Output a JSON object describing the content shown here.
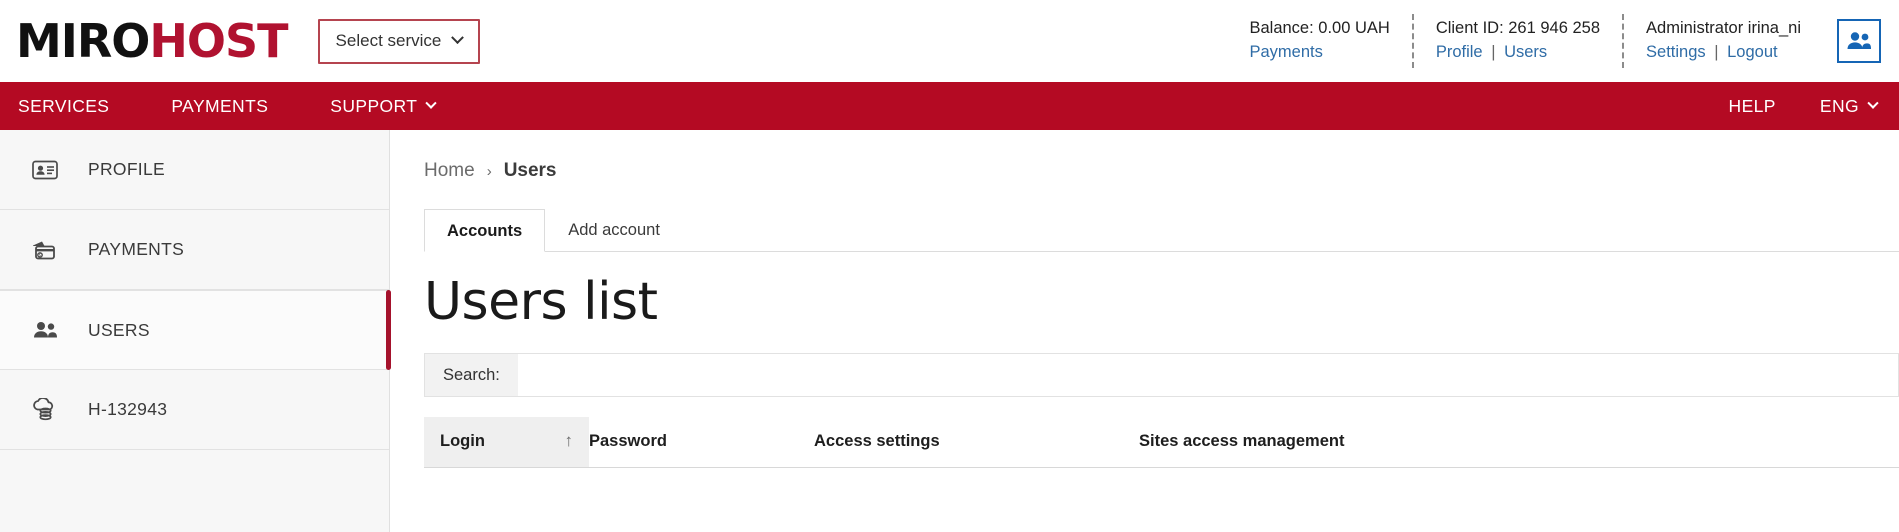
{
  "brand": {
    "logo_part1": "MIRO",
    "logo_part2": "HOST",
    "accent_red": "#b01230",
    "nav_red": "#b40a23",
    "link_blue": "#2f6ca6"
  },
  "header": {
    "select_service_label": "Select service",
    "balance": {
      "text": "Balance: 0.00 UAH",
      "link": "Payments"
    },
    "client": {
      "text": "Client ID: 261 946 258",
      "link_profile": "Profile",
      "separator": "|",
      "link_users": "Users"
    },
    "account": {
      "text": "Administrator irina_ni",
      "link_settings": "Settings",
      "separator": "|",
      "link_logout": "Logout"
    }
  },
  "nav": {
    "items": [
      {
        "label": "SERVICES",
        "has_caret": false
      },
      {
        "label": "PAYMENTS",
        "has_caret": false
      },
      {
        "label": "SUPPORT",
        "has_caret": true
      }
    ],
    "right_items": [
      {
        "label": "HELP",
        "has_caret": false
      },
      {
        "label": "ENG",
        "has_caret": true
      }
    ]
  },
  "sidebar": {
    "items": [
      {
        "label": "PROFILE",
        "icon": "id-card-icon",
        "active": false
      },
      {
        "label": "PAYMENTS",
        "icon": "credit-card-icon",
        "active": false
      },
      {
        "label": "USERS",
        "icon": "users-icon",
        "active": true
      },
      {
        "label": "H-132943",
        "icon": "hosting-icon",
        "active": false
      }
    ]
  },
  "main": {
    "breadcrumb": {
      "home": "Home",
      "chevron": "›",
      "current": "Users"
    },
    "tabs": [
      {
        "label": "Accounts",
        "active": true
      },
      {
        "label": "Add account",
        "active": false
      }
    ],
    "page_title": "Users list",
    "search": {
      "label": "Search:",
      "value": "",
      "placeholder": ""
    },
    "table": {
      "columns": [
        {
          "label": "Login",
          "sorted": true,
          "sort_arrow": "↑"
        },
        {
          "label": "Password",
          "sorted": false,
          "sort_arrow": ""
        },
        {
          "label": "Access settings",
          "sorted": false,
          "sort_arrow": ""
        },
        {
          "label": "Sites access management",
          "sorted": false,
          "sort_arrow": ""
        }
      ],
      "rows": []
    }
  }
}
